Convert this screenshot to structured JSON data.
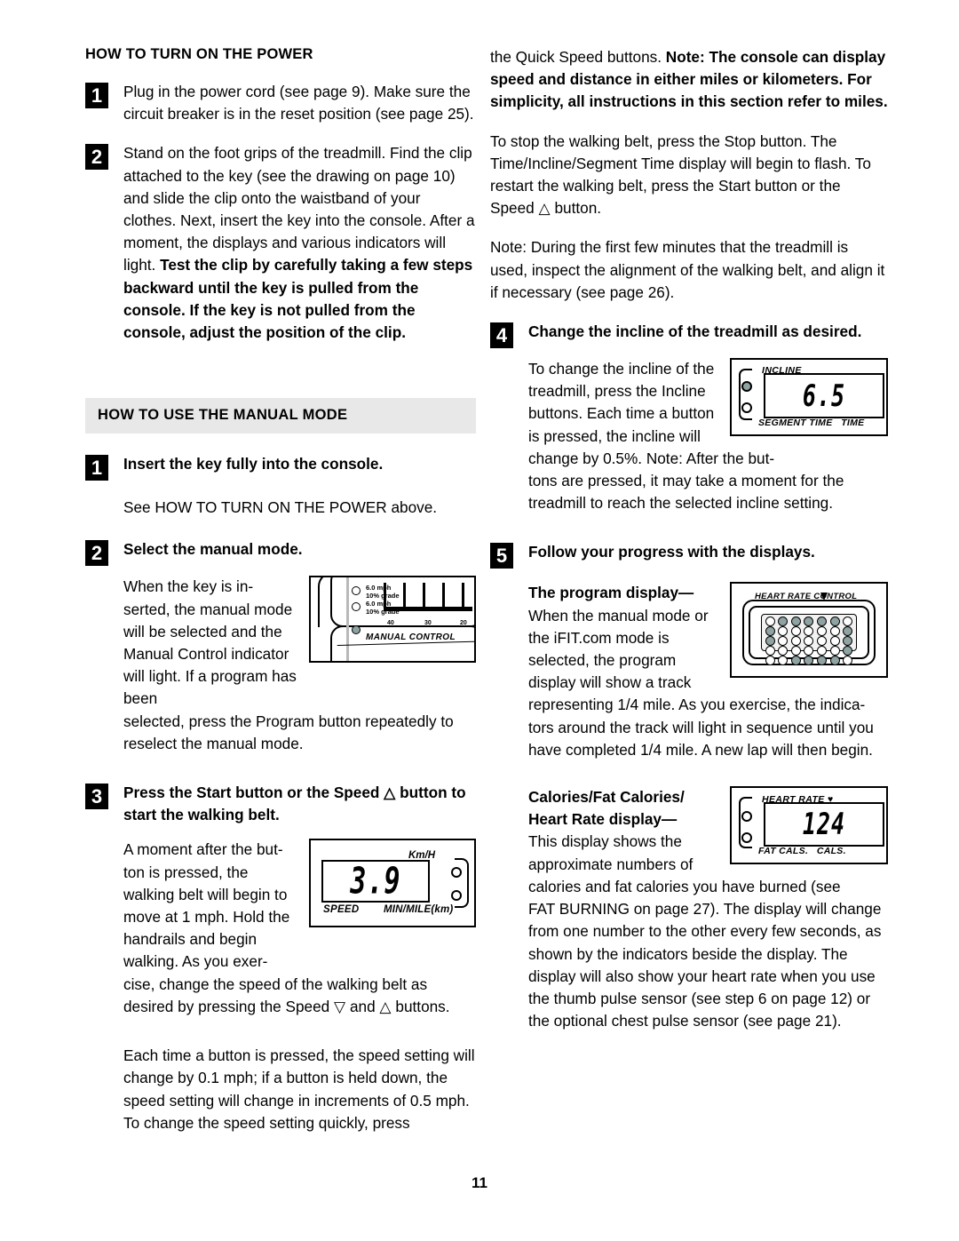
{
  "page": {
    "number": "11"
  },
  "left_column": {
    "heading": "HOW TO TURN ON THE POWER",
    "steps": [
      {
        "num": "1",
        "text": "Plug in the power cord (see page 9). Make sure the circuit breaker is in the reset position (see page 25)."
      },
      {
        "num": "2",
        "text_regular": "Stand on the foot grips of the treadmill. Find the clip attached to the key (see the drawing on page 10) and slide the clip onto the waistband of your clothes. Next, insert the key into the console. After a moment, the displays and various indicators will light. ",
        "text_bold": "Test the clip by carefully taking a few steps backward until the key is pulled from the console. If the key is not pulled from the console, adjust the position of the clip."
      }
    ],
    "band_heading": "HOW TO USE THE MANUAL MODE",
    "manual_steps": [
      {
        "num": "1",
        "title": "Insert the key fully into the console.",
        "body": "See HOW TO TURN ON THE POWER above."
      },
      {
        "num": "2",
        "title": "Select the manual mode.",
        "body_wrap": "When the key is in-serted, the manual mode will be selected and the Manual Control indicator will light. If a program has been",
        "body_rest": "selected, press the Program button repeatedly to reselect the manual mode."
      },
      {
        "num": "3",
        "title": "Press the Start button or the Speed △ button to start the walking belt.",
        "body_wrap": "A moment after the but-ton is pressed, the walking belt will begin to move at 1 mph. Hold the handrails and begin walking. As you exer-",
        "body_rest": "cise, change the speed of the walking belt as desired by pressing the Speed ▽ and △ buttons."
      }
    ],
    "closing_paragraph": "Each time a button is pressed, the speed setting will change by 0.1 mph; if a button is held down, the speed setting will change in increments of 0.5 mph. To change the speed setting quickly, press"
  },
  "right_column": {
    "continuation_regular": "the Quick Speed buttons. ",
    "continuation_bold": "Note: The console can display speed and distance in either miles or kilometers. For simplicity, all instructions in this section refer to miles.",
    "paragraph_stop": "To stop the walking belt, press the Stop button. The Time/Incline/Segment Time display will begin to flash. To restart the walking belt, press the Start button or the Speed △ button.",
    "paragraph_note": "Note: During the first few minutes that the treadmill is used, inspect the alignment of the walking belt, and align it if necessary (see page 26).",
    "steps": [
      {
        "num": "4",
        "title": "Change the incline of the treadmill as desired.",
        "body_wrap": "To change the incline of the treadmill, press the Incline buttons. Each time a button is pressed, the incline will change by 0.5%. Note: After the but-",
        "body_rest": "tons are pressed, it may take a moment for the treadmill to reach the selected incline setting."
      },
      {
        "num": "5",
        "title": "Follow your progress with the displays.",
        "sub1_bold": "The program display—",
        "sub1_wrap": "When the manual mode or the iFIT.com mode is selected, the program display will show a track representing 1/4 mile. As you exercise, the indica-",
        "sub1_rest": "tors around the track will light in sequence until you have completed 1/4 mile. A new lap will then begin.",
        "sub2_bold_line1": "Calories/Fat Calories/",
        "sub2_bold_line2": "Heart Rate display—",
        "sub2_wrap": "This display shows the approximate numbers of calories and fat calories you have burned (see",
        "sub2_rest": "FAT BURNING on page 27). The display will change from one number to the other every few seconds, as shown by the indicators beside the display. The display will also show your heart rate when you use the thumb pulse sensor (see step 6 on page 12) or the optional chest pulse sensor (see page 21)."
      }
    ]
  },
  "figures": {
    "manual_control": {
      "label": "MANUAL CONTROL",
      "readout_1_line1": "6.0 mph",
      "readout_1_line2": "10% grade",
      "readout_2_line1": "6.0 mph",
      "readout_2_line2": "10% grade",
      "axis_ticks": [
        "40",
        "30",
        "20"
      ],
      "indicator_state": "on"
    },
    "speed_display": {
      "value": "3.9",
      "label_top_right": "Km/H",
      "label_bottom_left": "SPEED",
      "label_bottom_right": "MIN/MILE(km)",
      "indicators": [
        "off",
        "off"
      ]
    },
    "incline_display": {
      "value": "6.5",
      "label_top": "INCLINE",
      "label_bottom_left": "SEGMENT TIME",
      "label_bottom_right": "TIME",
      "indicators": [
        "on",
        "off"
      ]
    },
    "program_display": {
      "caption": "HEART RATE CONTROL",
      "grid_rows": [
        [
          "off",
          "on",
          "on",
          "on",
          "on",
          "on",
          "off"
        ],
        [
          "on",
          "off",
          "off",
          "off",
          "off",
          "off",
          "on"
        ],
        [
          "on",
          "off",
          "off",
          "off",
          "off",
          "off",
          "on"
        ],
        [
          "off",
          "off",
          "off",
          "off",
          "off",
          "off",
          "on"
        ],
        [
          "off",
          "off",
          "on",
          "on",
          "on",
          "on",
          "off"
        ]
      ]
    },
    "heart_rate_display": {
      "value": "124",
      "label_top": "HEART RATE ♥",
      "label_bottom_left": "FAT CALS.",
      "label_bottom_right": "CALS.",
      "indicators": [
        "off",
        "off"
      ]
    }
  },
  "colors": {
    "band_background": "#e8e8e8",
    "indicator_on": "#8fa3a3",
    "text": "#000000"
  }
}
